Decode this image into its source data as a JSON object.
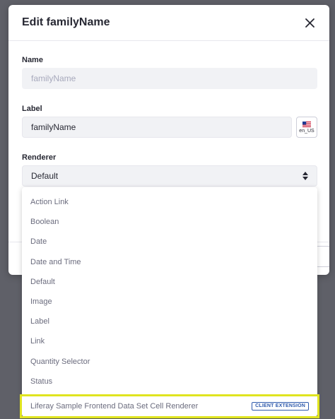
{
  "modal": {
    "title": "Edit familyName",
    "close_icon": "close-icon"
  },
  "name_field": {
    "label": "Name",
    "value": "familyName"
  },
  "label_field": {
    "label": "Label",
    "value": "familyName",
    "locale": "en_US",
    "locale_icon": "us-flag-icon"
  },
  "renderer_field": {
    "label": "Renderer",
    "selected": "Default",
    "icon": "select-arrows-icon"
  },
  "renderer_options": [
    {
      "label": "Action Link"
    },
    {
      "label": "Boolean"
    },
    {
      "label": "Date"
    },
    {
      "label": "Date and Time"
    },
    {
      "label": "Default"
    },
    {
      "label": "Image"
    },
    {
      "label": "Label"
    },
    {
      "label": "Link"
    },
    {
      "label": "Quantity Selector"
    },
    {
      "label": "Status"
    },
    {
      "label": "Liferay Sample Frontend Data Set Cell Renderer",
      "badge": "CLIENT EXTENSION"
    }
  ],
  "colors": {
    "highlight": "#e0e41f",
    "badge": "#2e5aac",
    "backdrop": "#5f6068"
  }
}
